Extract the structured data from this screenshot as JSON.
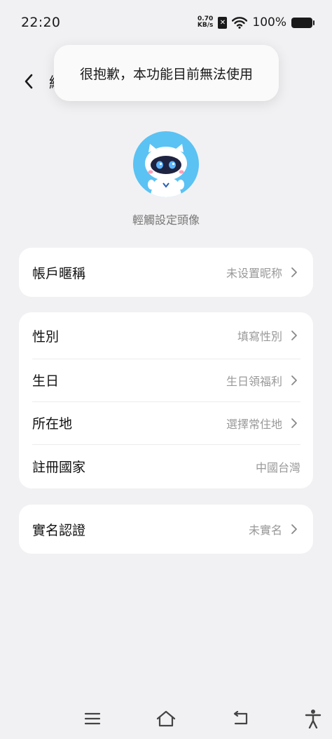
{
  "status_bar": {
    "time": "22:20",
    "net_speed_value": "0.70",
    "net_speed_unit": "KB/s",
    "battery_percent": "100%",
    "icons": [
      "sim-no-signal-icon",
      "wifi-icon",
      "battery-icon"
    ]
  },
  "header": {
    "title_partial": "編"
  },
  "toast": {
    "message": "很抱歉，本功能目前無法使用"
  },
  "avatar": {
    "hint": "輕觸設定頭像"
  },
  "card_nickname": {
    "rows": [
      {
        "label": "帳戶暱稱",
        "value": "未设置昵称"
      }
    ]
  },
  "card_profile": {
    "rows": [
      {
        "label": "性別",
        "value": "填寫性別"
      },
      {
        "label": "生日",
        "value": "生日領福利"
      },
      {
        "label": "所在地",
        "value": "選擇常住地"
      },
      {
        "label": "註冊國家",
        "value": "中國台灣"
      }
    ]
  },
  "card_verify": {
    "rows": [
      {
        "label": "實名認證",
        "value": "未實名"
      }
    ]
  },
  "colors": {
    "background": "#f1f1f3",
    "card": "#ffffff",
    "avatar_bg": "#5bc2f4",
    "secondary_text": "#999999"
  }
}
